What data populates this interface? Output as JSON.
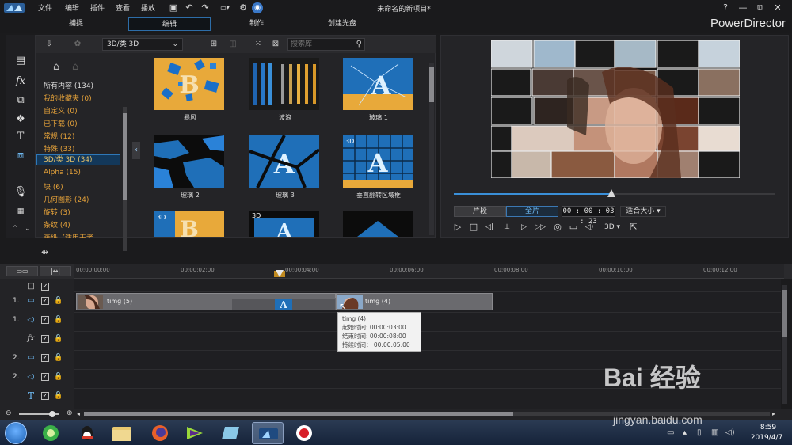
{
  "menu": [
    "文件",
    "编辑",
    "插件",
    "查看",
    "播放"
  ],
  "window": {
    "title": "未命名的新项目*",
    "help": "?",
    "minimize": "—",
    "restore": "⧉",
    "close": "✕"
  },
  "modes": {
    "tabs": [
      "捕捉",
      "编辑",
      "制作",
      "创建光盘"
    ],
    "active": "编辑",
    "brand": "PowerDirector"
  },
  "library": {
    "category_select": "3D/类 3D",
    "search_placeholder": "搜索库",
    "categories": [
      {
        "label": "所有内容 (134)"
      },
      {
        "label": "我的收藏夹  (0)"
      },
      {
        "label": "自定义  (0)"
      },
      {
        "label": "已下载  (0)"
      },
      {
        "label": "常规  (12)"
      },
      {
        "label": "特殊  (33)"
      },
      {
        "label": "3D/类 3D  (34)"
      },
      {
        "label": "Alpha  (15)"
      },
      {
        "label": "块  (6)"
      },
      {
        "label": "几何图形  (24)"
      },
      {
        "label": "旋转  (3)"
      },
      {
        "label": "条纹  (4)"
      },
      {
        "label": "画纸（适用于老"
      }
    ],
    "selected_category": "3D/类 3D  (34)",
    "thumbnails": [
      {
        "label": "暴风",
        "badge": ""
      },
      {
        "label": "波浪",
        "badge": ""
      },
      {
        "label": "玻璃 1",
        "badge": ""
      },
      {
        "label": "玻璃 2",
        "badge": ""
      },
      {
        "label": "玻璃 3",
        "badge": ""
      },
      {
        "label": "垂直翻转区域框",
        "badge": "3D"
      },
      {
        "label": "",
        "badge": "3D"
      },
      {
        "label": "",
        "badge": "3D"
      },
      {
        "label": "",
        "badge": ""
      }
    ],
    "thumb_letters": [
      "B",
      "A",
      "A",
      "A",
      "B",
      "A"
    ]
  },
  "preview": {
    "clip_mode": "片段",
    "full_mode": "全片",
    "timecode": "00 : 00 : 03 : 23",
    "zoom": "适合大小 ▾",
    "progress": 0.49,
    "controls": {
      "play": "▷",
      "stop": "□",
      "prev": "◁|",
      "next": "|▷",
      "ff": "▷▷",
      "snapshot": "◎",
      "subtitle": "▭",
      "volume": "◁)",
      "three_d": "3D ▾",
      "undock": "⇱"
    }
  },
  "timeline": {
    "ruler": [
      "00:00:00:00",
      "00:00:02:00",
      "00:00:04:00",
      "00:00:06:00",
      "00:00:08:00",
      "00:00:10:00",
      "00:00:12:00"
    ],
    "tracks": [
      {
        "num": "",
        "icon": "□"
      },
      {
        "num": "1.",
        "icon": "▭"
      },
      {
        "num": "1.",
        "icon": "◁)"
      },
      {
        "num": "",
        "icon": "fx"
      },
      {
        "num": "2.",
        "icon": "▭"
      },
      {
        "num": "2.",
        "icon": "◁)"
      },
      {
        "num": "",
        "icon": "T"
      }
    ],
    "clips": [
      {
        "label": "timg (5)"
      },
      {
        "label": "timg (4)"
      }
    ],
    "tooltip": {
      "name": "timg (4)",
      "start": "起始时间: 00:00:03:00",
      "end": "结束时间: 00:00:08:00",
      "duration": "持续时间： 00:00:05:00"
    }
  },
  "taskbar": {
    "time": "8:59",
    "date": "2019/4/7"
  },
  "watermark": {
    "text": "Bai 经验",
    "url": "jingyan.baidu.com"
  },
  "colors": {
    "accent": "#3a8fd8",
    "category_text": "#e5a23a",
    "playhead": "#d43a3a"
  }
}
